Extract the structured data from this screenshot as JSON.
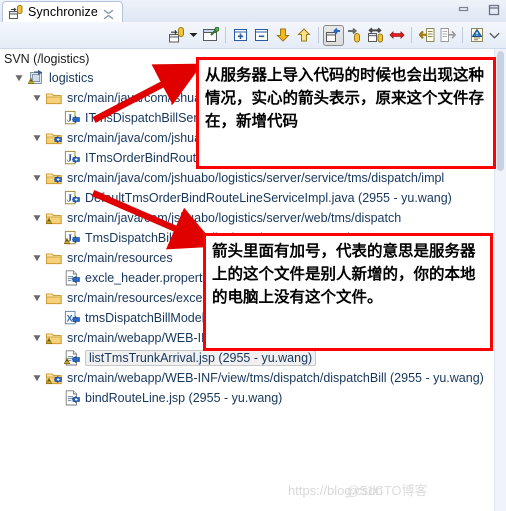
{
  "window": {
    "tab_title": "Synchronize",
    "tab_icon": "synchronize-icon",
    "close_icon": "close-tab-icon",
    "minimize_label": "Minimize",
    "maximize_label": "Maximize"
  },
  "toolbar": {
    "items": [
      {
        "name": "synchronize-mode-button",
        "icon": "synchronize-icon",
        "pressed": false
      },
      {
        "name": "synchronize-dropdown-button",
        "icon": "chevron-down-icon",
        "pressed": false
      },
      {
        "name": "open-in-compare-editor-button",
        "icon": "compare-editor-icon",
        "pressed": false
      },
      {
        "name": "separator-1",
        "icon": "separator",
        "pressed": false
      },
      {
        "name": "expand-all-button",
        "icon": "expand-all-icon",
        "pressed": false
      },
      {
        "name": "collapse-all-button",
        "icon": "collapse-all-icon",
        "pressed": false
      },
      {
        "name": "next-change-button",
        "icon": "arrow-down-icon",
        "pressed": false
      },
      {
        "name": "previous-change-button",
        "icon": "arrow-up-icon",
        "pressed": false
      },
      {
        "name": "separator-2",
        "icon": "separator",
        "pressed": false
      },
      {
        "name": "incoming-mode-button",
        "icon": "incoming-mode-icon",
        "pressed": true
      },
      {
        "name": "outgoing-mode-button",
        "icon": "outgoing-mode-icon",
        "pressed": false
      },
      {
        "name": "incoming-outgoing-mode-button",
        "icon": "incoming-outgoing-icon",
        "pressed": false
      },
      {
        "name": "conflicts-mode-button",
        "icon": "conflicts-icon",
        "pressed": false
      },
      {
        "name": "separator-3",
        "icon": "separator",
        "pressed": false
      },
      {
        "name": "update-button",
        "icon": "update-icon",
        "pressed": false
      },
      {
        "name": "commit-button",
        "icon": "commit-icon",
        "pressed": false
      },
      {
        "name": "separator-4",
        "icon": "separator",
        "pressed": false
      },
      {
        "name": "show-annotations-button",
        "icon": "annotate-icon",
        "pressed": false
      },
      {
        "name": "view-menu-button",
        "icon": "view-menu-icon",
        "pressed": false
      }
    ]
  },
  "tree": {
    "root_label": "SVN (/logistics)",
    "rows": [
      {
        "name": "tree-row-project-logistics",
        "indent": 1,
        "twisty": "expanded",
        "icon": "project-folder-conflict-icon",
        "label": "logistics",
        "selected": false
      },
      {
        "name": "tree-row-folder-service-tms-dispatch",
        "indent": 2,
        "twisty": "expanded",
        "icon": "folder-outgoing-icon",
        "label": "src/main/java/com/jshuabo/logistics/server/service/tms/dispatch",
        "selected": false
      },
      {
        "name": "tree-row-file-itmsdispatchbill",
        "indent": 3,
        "twisty": "none",
        "icon": "java-file-incoming-icon",
        "label": "ITmsDispatchBillService.java (2955 - yu.wang)",
        "selected": false
      },
      {
        "name": "tree-row-folder-service-tms-dispatch-2",
        "indent": 2,
        "twisty": "expanded",
        "icon": "folder-incoming-add-icon",
        "label": "src/main/java/com/jshuabo/logistics/server/service/tms/dispatch",
        "selected": false
      },
      {
        "name": "tree-row-file-itmsorderbindroutelineservice",
        "indent": 3,
        "twisty": "none",
        "icon": "java-file-incoming-add-icon",
        "label": "ITmsOrderBindRouteLineService.java (2955 - yu.wang)",
        "selected": false
      },
      {
        "name": "tree-row-folder-service-tms-dispatch-impl",
        "indent": 2,
        "twisty": "expanded",
        "icon": "folder-incoming-add-icon",
        "label": "src/main/java/com/jshuabo/logistics/server/service/tms/dispatch/impl",
        "selected": false
      },
      {
        "name": "tree-row-file-defaulttmsorderbindroutelineserviceimpl",
        "indent": 3,
        "twisty": "none",
        "icon": "java-file-incoming-add-icon",
        "label": "DefaultTmsOrderBindRouteLineServiceImpl.java (2955 - yu.wang)",
        "selected": false
      },
      {
        "name": "tree-row-folder-web-tms-dispatch",
        "indent": 2,
        "twisty": "expanded",
        "icon": "folder-conflict-icon",
        "label": "src/main/java/com/jshuabo/logistics/server/web/tms/dispatch",
        "selected": false
      },
      {
        "name": "tree-row-file-tmsdispatchbillcontroller",
        "indent": 3,
        "twisty": "none",
        "icon": "java-file-conflict-incoming-icon",
        "label": "TmsDispatchBillController.java (2955 - yu.wang)",
        "selected": false
      },
      {
        "name": "tree-row-folder-resources",
        "indent": 2,
        "twisty": "expanded",
        "icon": "folder-outgoing-icon",
        "label": "src/main/resources",
        "selected": false
      },
      {
        "name": "tree-row-file-excle-header",
        "indent": 3,
        "twisty": "none",
        "icon": "properties-file-incoming-icon",
        "label": "excle_header.properties (2955 - yu.wang)",
        "selected": false
      },
      {
        "name": "tree-row-folder-resources-2",
        "indent": 2,
        "twisty": "expanded",
        "icon": "folder-outgoing-icon",
        "label": "src/main/resources/excel",
        "selected": false
      },
      {
        "name": "tree-row-file-tmsdispatchbillmodel",
        "indent": 3,
        "twisty": "none",
        "icon": "excel-file-incoming-icon",
        "label": "tmsDispatchBillModel.xls (2955 - yu.wang)",
        "selected": false
      },
      {
        "name": "tree-row-folder-webapp-web-inf",
        "indent": 2,
        "twisty": "expanded",
        "icon": "folder-conflict-icon",
        "label": "src/main/webapp/WEB-INF/view/tms/dispatch",
        "selected": false
      },
      {
        "name": "tree-row-file-listtmstrunkarrival",
        "indent": 3,
        "twisty": "none",
        "icon": "jsp-file-conflict-incoming-icon",
        "label": "listTmsTrunkArrival.jsp (2955 - yu.wang)",
        "selected": true
      },
      {
        "name": "tree-row-folder-webapp-dispatchbill",
        "indent": 2,
        "twisty": "expanded",
        "icon": "folder-conflict-incoming-icon",
        "label": "src/main/webapp/WEB-INF/view/tms/dispatch/dispatchBill (2955 - yu.wang)",
        "selected": false
      },
      {
        "name": "tree-row-file-bindrouteline",
        "indent": 3,
        "twisty": "none",
        "icon": "jsp-file-incoming-add-icon",
        "label": "bindRouteLine.jsp (2955 - yu.wang)",
        "selected": false
      }
    ]
  },
  "annotations": [
    {
      "name": "annotation-callout-solid-arrow",
      "text": "从服务器上导入代码的时候也会出现这种情况，实心的箭头表示，原来这个文件存在，新增代码",
      "border_color": "#ff0000"
    },
    {
      "name": "annotation-callout-plus-arrow",
      "text": "箭头里面有加号，代表的意思是服务器上的这个文件是别人新增的，你的本地的电脑上没有这个文件。",
      "border_color": "#ff0000"
    }
  ],
  "watermark": {
    "text_1": "https://blog.csdn",
    "text_2": "@51CTO博客"
  },
  "colors": {
    "annotation_red": "#ff0000",
    "tree_text": "#17365d",
    "folder_yellow": "#f5c24c",
    "incoming_blue": "#3b7ddd"
  }
}
